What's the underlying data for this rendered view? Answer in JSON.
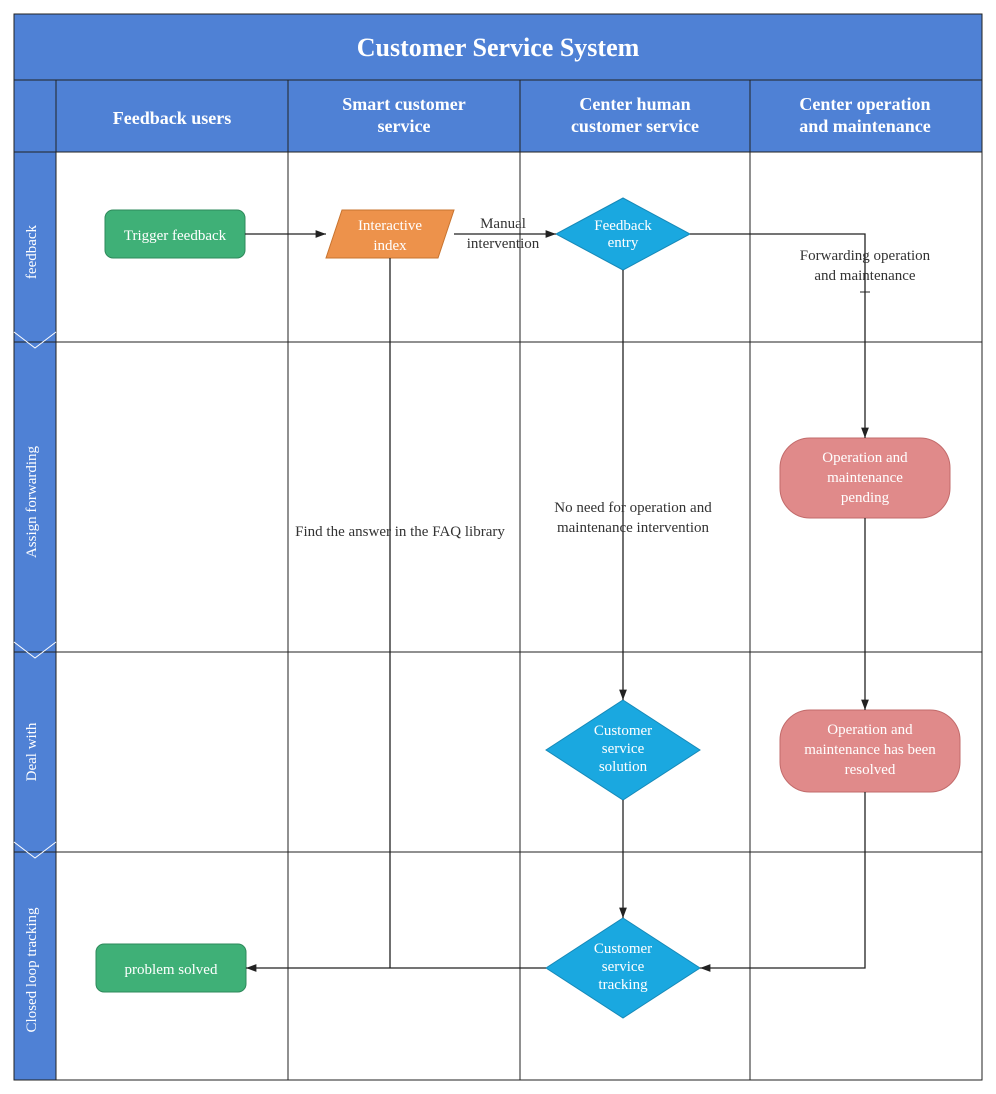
{
  "title": "Customer Service System",
  "columns": [
    "Feedback users",
    "Smart customer service",
    "Center human customer service",
    "Center operation and maintenance"
  ],
  "rows": [
    "feedback",
    "Assign forwarding",
    "Deal with",
    "Closed loop tracking"
  ],
  "nodes": {
    "trigger_feedback": "Trigger feedback",
    "interactive_index_l1": "Interactive",
    "interactive_index_l2": "index",
    "feedback_entry_l1": "Feedback",
    "feedback_entry_l2": "entry",
    "om_pending_l1": "Operation and",
    "om_pending_l2": "maintenance",
    "om_pending_l3": "pending",
    "cs_solution_l1": "Customer",
    "cs_solution_l2": "service",
    "cs_solution_l3": "solution",
    "om_resolved_l1": "Operation and",
    "om_resolved_l2": "maintenance has been",
    "om_resolved_l3": "resolved",
    "cs_tracking_l1": "Customer",
    "cs_tracking_l2": "service",
    "cs_tracking_l3": "tracking",
    "problem_solved": "problem solved"
  },
  "edges": {
    "manual_l1": "Manual",
    "manual_l2": "intervention",
    "forward_l1": "Forwarding operation",
    "forward_l2": "and maintenance",
    "faq": "Find the answer in the FAQ library",
    "noneed_l1": "No need for operation and",
    "noneed_l2": "maintenance intervention"
  },
  "colors": {
    "blue_header": "#4f81d5",
    "green": "#3fb077",
    "orange": "#ed924b",
    "cyan": "#1aa8e0",
    "pink": "#e08a8a",
    "border": "#222"
  }
}
